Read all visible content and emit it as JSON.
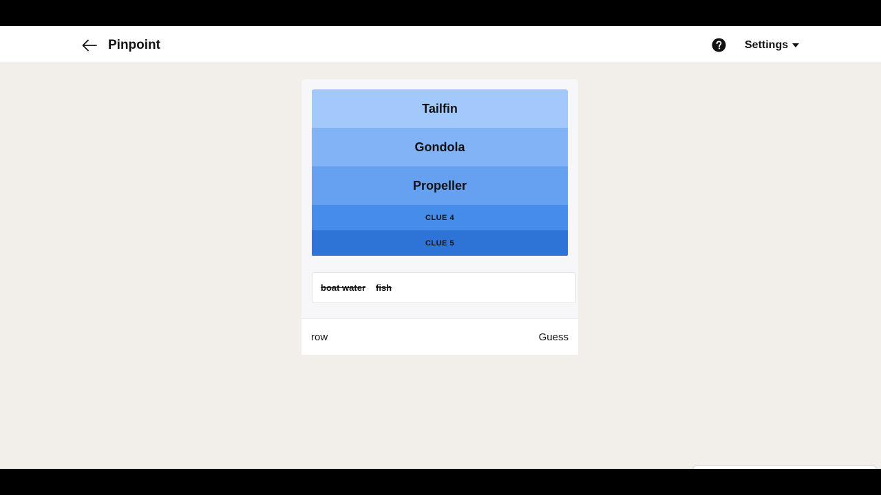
{
  "header": {
    "back_icon": "arrow-left-icon",
    "title": "Pinpoint",
    "help_icon": "question-circle-icon",
    "settings_label": "Settings",
    "settings_icon": "caret-down-icon"
  },
  "colors": {
    "clue_1": "#a3c8fb",
    "clue_2": "#82b3f6",
    "clue_3": "#66a0f1",
    "clue_4": "#468ce9",
    "clue_5": "#2e74d6"
  },
  "clues": [
    {
      "text": "Tailfin",
      "revealed": true
    },
    {
      "text": "Gondola",
      "revealed": true
    },
    {
      "text": "Propeller",
      "revealed": true
    },
    {
      "text": "CLUE 4",
      "revealed": false
    },
    {
      "text": "CLUE 5",
      "revealed": false
    }
  ],
  "guesses": [
    "boat water",
    "fish"
  ],
  "input": {
    "value": "row",
    "button_label": "Guess"
  }
}
